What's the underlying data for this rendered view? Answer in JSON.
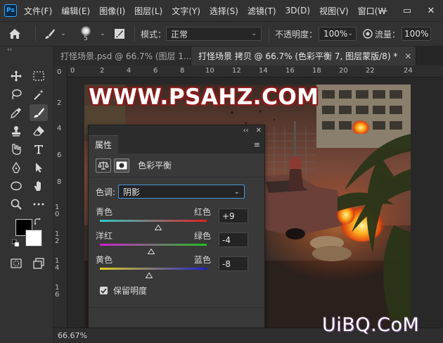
{
  "app": {
    "logo": "Ps",
    "menu": [
      "文件(F)",
      "编辑(E)",
      "图像(I)",
      "图层(L)",
      "文字(Y)",
      "选择(S)",
      "滤镜(T)",
      "3D(D)",
      "视图(V)",
      "窗口(W"
    ],
    "window_controls": {
      "minimize": "—",
      "restore": "▭",
      "close": "✕"
    }
  },
  "options": {
    "brush_size": "5",
    "mode_label": "模式：",
    "mode_value": "正常",
    "opacity_label": "不透明度：",
    "opacity_value": "100%",
    "flow_label": "流量：",
    "flow_value": "100%"
  },
  "tabs": [
    {
      "label": "打怪场景.psd @ 66.7% (图层 1...",
      "close": "✕",
      "active": false
    },
    {
      "label": "打怪场景 拷贝 @ 66.7% (色彩平衡 7, 图层蒙版/8) *",
      "close": "✕",
      "active": true
    }
  ],
  "toolbar": {
    "collapse": "‹‹"
  },
  "ruler": {
    "h_ticks": [
      "0",
      "2",
      "4",
      "6",
      "8",
      "10",
      "12",
      "14",
      "16",
      "18",
      "20",
      "22",
      "24"
    ]
  },
  "status": {
    "zoom": "66.67%"
  },
  "watermarks": {
    "top": "WWW.PSAHZ.COM",
    "bottom": "UiBQ.CoM"
  },
  "properties": {
    "collapse": "‹‹",
    "close": "✕",
    "tab": "属性",
    "menu": "≡",
    "title": "色彩平衡",
    "tone_label": "色调:",
    "tone_value": "阴影",
    "sliders": [
      {
        "left": "青色",
        "right": "红色",
        "value": "+9",
        "amount": 9,
        "from": "#2fc8c8",
        "to": "#e02020"
      },
      {
        "left": "洋红",
        "right": "绿色",
        "value": "-4",
        "amount": -4,
        "from": "#d020d0",
        "to": "#20c020"
      },
      {
        "left": "黄色",
        "right": "蓝色",
        "value": "-8",
        "amount": -8,
        "from": "#e0d020",
        "to": "#2020d0"
      }
    ],
    "preserve_label": "保留明度",
    "preserve_checked": true
  },
  "colors": {
    "accent": "#31a8ff",
    "panel": "#393939",
    "chrome": "#323232"
  }
}
